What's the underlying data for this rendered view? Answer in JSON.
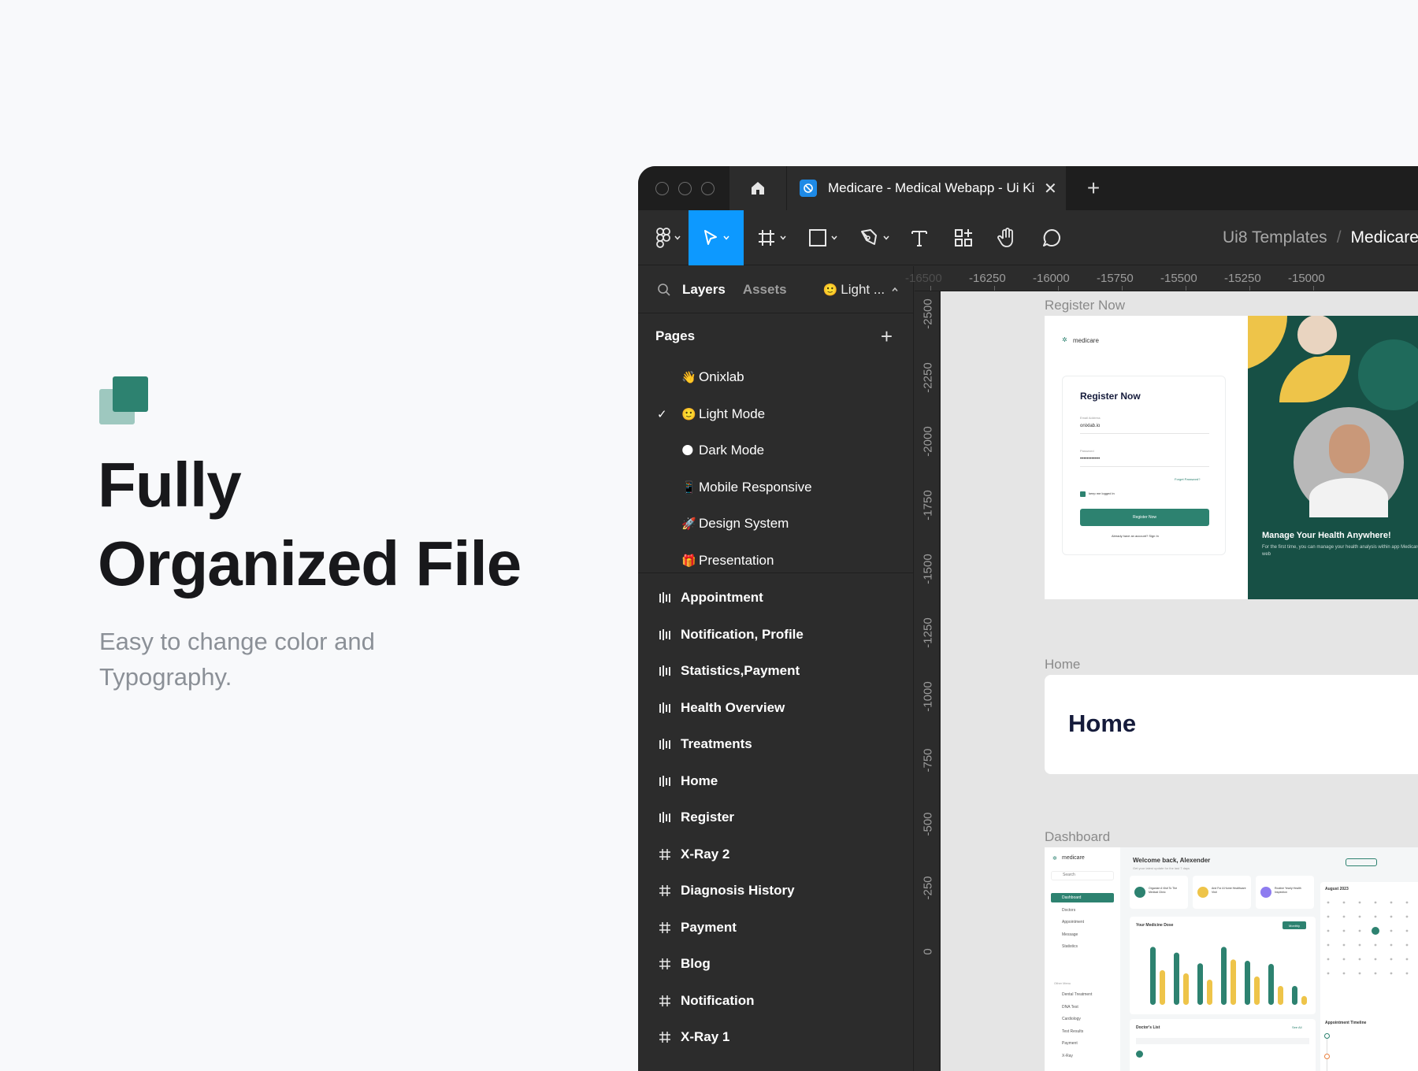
{
  "hero": {
    "title_line1": "Fully",
    "title_line2": "Organized File",
    "subtitle": "Easy to change color and Typography."
  },
  "window": {
    "tab_title": "Medicare - Medical Webapp - Ui Ki",
    "breadcrumb_team": "Ui8 Templates",
    "breadcrumb_sep": "/",
    "breadcrumb_project": "Medicare"
  },
  "panel": {
    "tab_layers": "Layers",
    "tab_assets": "Assets",
    "current_page": "Light ...",
    "current_page_emoji": "🙂",
    "pages_heading": "Pages",
    "pages": [
      {
        "emoji": "👋",
        "label": "Onixlab",
        "selected": false
      },
      {
        "emoji": "🙂",
        "label": "Light Mode",
        "selected": true
      },
      {
        "emoji": "🌑",
        "label": "Dark Mode",
        "selected": false
      },
      {
        "emoji": "📱",
        "label": "Mobile Responsive",
        "selected": false
      },
      {
        "emoji": "🚀",
        "label": "Design System",
        "selected": false
      },
      {
        "emoji": "🎁",
        "label": "Presentation",
        "selected": false
      }
    ],
    "layers": [
      {
        "icon": "section-icon",
        "label": "Appointment"
      },
      {
        "icon": "section-icon",
        "label": "Notification, Profile"
      },
      {
        "icon": "section-icon",
        "label": "Statistics,Payment"
      },
      {
        "icon": "section-icon",
        "label": "Health Overview"
      },
      {
        "icon": "section-icon",
        "label": "Treatments"
      },
      {
        "icon": "section-icon",
        "label": "Home"
      },
      {
        "icon": "section-icon",
        "label": "Register"
      },
      {
        "icon": "frame-icon",
        "label": "X-Ray 2"
      },
      {
        "icon": "frame-icon",
        "label": "Diagnosis History"
      },
      {
        "icon": "frame-icon",
        "label": "Payment"
      },
      {
        "icon": "frame-icon",
        "label": "Blog"
      },
      {
        "icon": "frame-icon",
        "label": "Notification"
      },
      {
        "icon": "frame-icon",
        "label": "X-Ray 1"
      }
    ]
  },
  "rulers": {
    "top": [
      "-16500",
      "-16250",
      "-16000",
      "-15750",
      "-15500",
      "-15250",
      "-15000"
    ],
    "left": [
      "-2500",
      "-2250",
      "-2000",
      "-1750",
      "-1500",
      "-1250",
      "-1000",
      "-750",
      "-500",
      "-250",
      "0"
    ]
  },
  "canvas": {
    "register_label": "Register Now",
    "home_label": "Home",
    "dashboard_label": "Dashboard",
    "register": {
      "brand": "medicare",
      "form_title": "Register Now",
      "email_label": "Email Address",
      "email_value": "onixlab.io",
      "password_label": "Password",
      "password_value": "••••••••••••",
      "forgot": "Forget Password?",
      "keep": "keep me logged in",
      "button": "Register Now",
      "signin": "Already have an account? Sign In",
      "hero_title": "Manage Your Health Anywhere!",
      "hero_text": "For the first time, you can manage your health analysis within app Medicare on the web"
    },
    "home_title": "Home",
    "dashboard": {
      "brand": "medicare",
      "welcome": "Welcome back, Alexender",
      "welcome_sub": "Get your latest update for the last 7 days",
      "search": "Search",
      "menu": [
        "Dashboard",
        "Doctors",
        "Appointment",
        "Message",
        "Statistics"
      ],
      "other_menu_label": "Other Menu",
      "other_menu": [
        "Dental Treatment",
        "DNA Test",
        "Cardiology",
        "Test Results",
        "Payment",
        "X-Ray"
      ],
      "cards": [
        "Organize A Visit To The Medical Clinic",
        "And For A Home Healthcare Visit",
        "Routine Yearly Health Inspection"
      ],
      "chart_title": "Your Medicine Dose",
      "chart_filter": "Monthly",
      "doctors_title": "Doctor's List",
      "doctors_see_all": "See All",
      "calendar_title": "August 2023",
      "timeline_title": "Appointment Timeline",
      "chart_bars": [
        0.92,
        0.55,
        0.83,
        0.5,
        0.66,
        0.4,
        0.92,
        0.72,
        0.7,
        0.45,
        0.65,
        0.3,
        0.3,
        0.14
      ]
    }
  },
  "colors": {
    "accent_blue": "#0d99ff",
    "brand_green": "#2d8270",
    "panel_bg": "#2c2c2c",
    "titlebar_bg": "#1e1e1e"
  }
}
